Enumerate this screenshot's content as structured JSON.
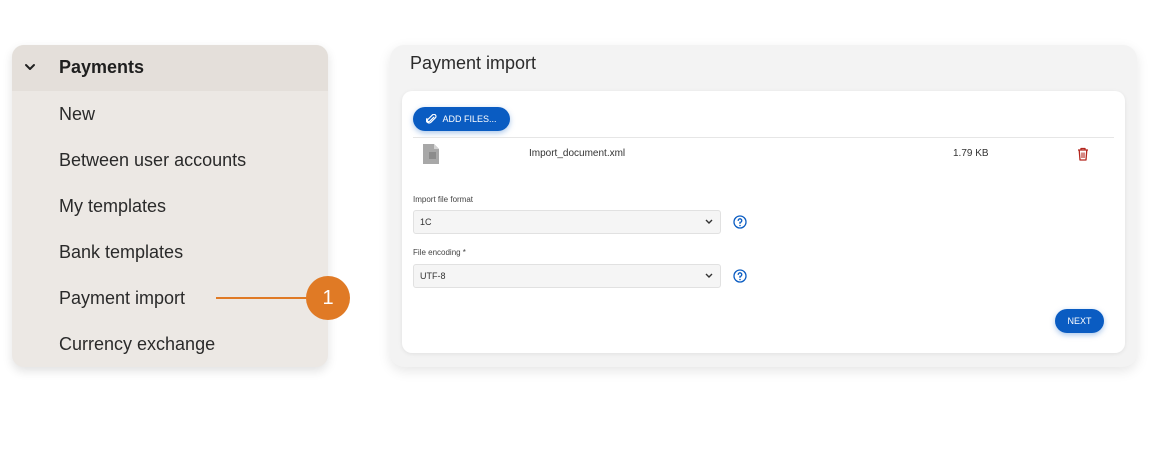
{
  "sidebar": {
    "section_title": "Payments",
    "items": [
      {
        "label": "New"
      },
      {
        "label": "Between user accounts"
      },
      {
        "label": "My templates"
      },
      {
        "label": "Bank templates"
      },
      {
        "label": "Payment import"
      },
      {
        "label": "Currency exchange"
      }
    ]
  },
  "annotation": {
    "number": "1"
  },
  "panel": {
    "title": "Payment import",
    "add_files_label": "ADD FILES...",
    "file": {
      "name": "Import_document.xml",
      "size": "1.79 KB"
    },
    "format": {
      "label": "Import file format",
      "value": "1C"
    },
    "encoding": {
      "label": "File encoding *",
      "value": "UTF-8"
    },
    "next_label": "NEXT"
  },
  "colors": {
    "accent": "#0a5cc2",
    "annotation": "#e07a25",
    "sidebar_bg": "#ece8e4",
    "trash": "#b3261e"
  },
  "icons": [
    "chevron-down-icon",
    "paperclip-icon",
    "file-icon",
    "trash-icon",
    "help-icon"
  ]
}
